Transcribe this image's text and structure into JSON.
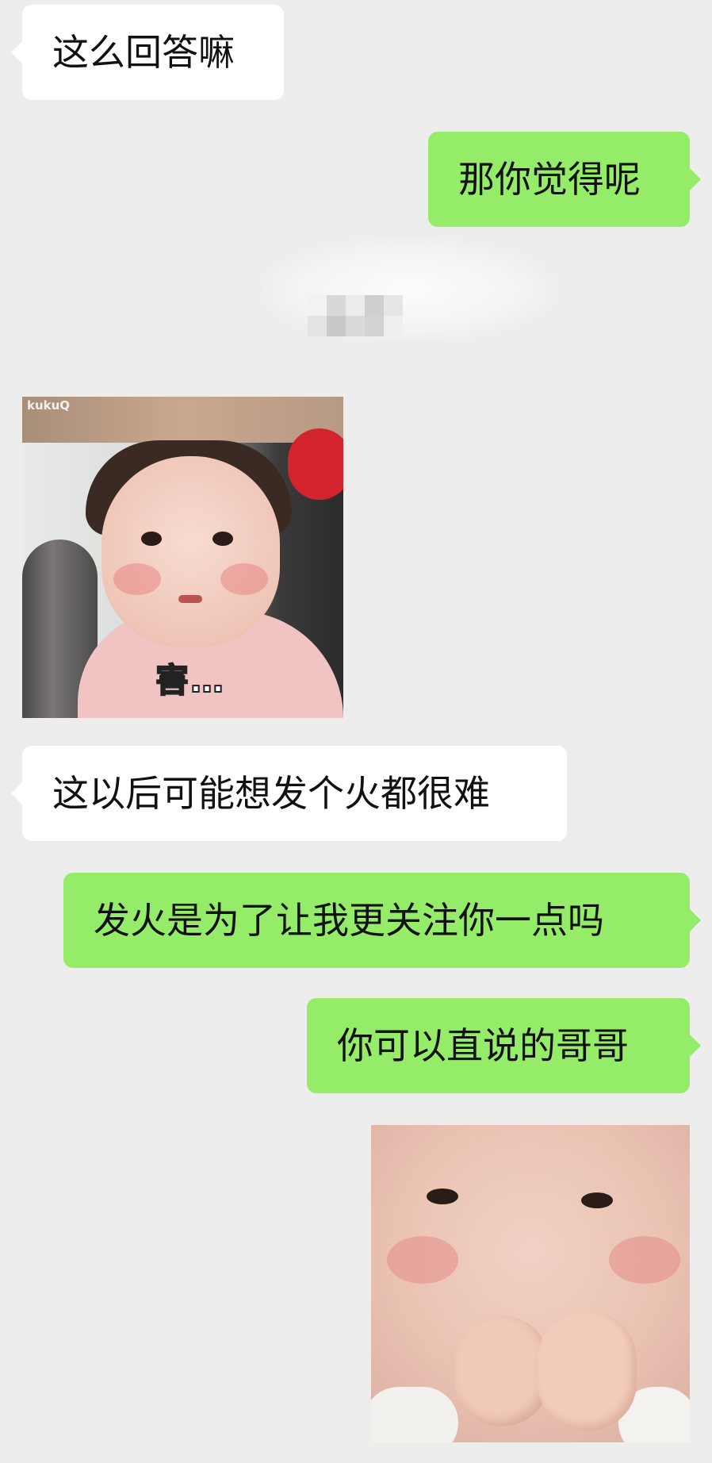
{
  "messages": [
    {
      "side": "in",
      "text": "这么回答嘛"
    },
    {
      "side": "out",
      "text": "那你觉得呢"
    },
    {
      "side": "in",
      "text": "这以后可能想发个火都很难"
    },
    {
      "side": "out",
      "text": "发火是为了让我更关注你一点吗"
    },
    {
      "side": "out",
      "text": "你可以直说的哥哥"
    }
  ],
  "stickers": {
    "sticker1": {
      "caption": "害…",
      "logo": "kukuQ"
    }
  },
  "colors": {
    "background": "#ededed",
    "incoming_bubble": "#ffffff",
    "outgoing_bubble": "#95ec69"
  }
}
